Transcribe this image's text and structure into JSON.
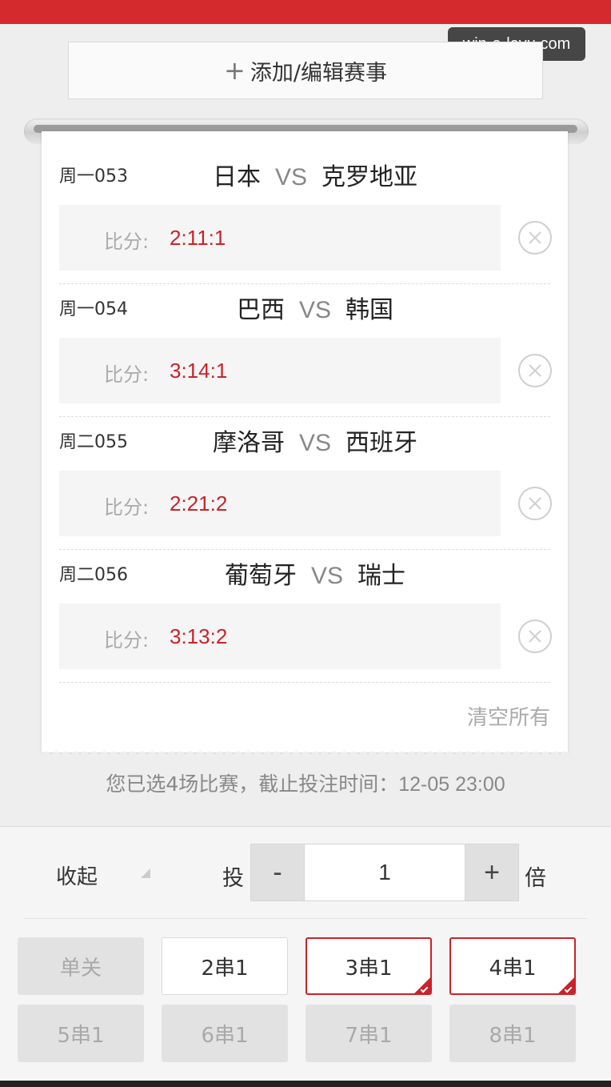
{
  "watermark": "win-e-leyu.com",
  "add_button": {
    "icon": "plus-icon",
    "label": "添加/编辑赛事"
  },
  "matches": [
    {
      "code": "周一053",
      "home": "日本",
      "vs": "VS",
      "away": "克罗地亚",
      "score_label": "比分:",
      "score": "2:11:1"
    },
    {
      "code": "周一054",
      "home": "巴西",
      "vs": "VS",
      "away": "韩国",
      "score_label": "比分:",
      "score": "3:14:1"
    },
    {
      "code": "周二055",
      "home": "摩洛哥",
      "vs": "VS",
      "away": "西班牙",
      "score_label": "比分:",
      "score": "2:21:2"
    },
    {
      "code": "周二056",
      "home": "葡萄牙",
      "vs": "VS",
      "away": "瑞士",
      "score_label": "比分:",
      "score": "3:13:2"
    }
  ],
  "clear_all": "清空所有",
  "summary": {
    "text": "您已选4场比赛，截止投注时间：",
    "deadline": "12-05 23:00"
  },
  "controls": {
    "collapse": "收起",
    "bet": "投",
    "minus": "-",
    "multiplier": "1",
    "plus": "+",
    "times": "倍"
  },
  "pass_types": [
    {
      "label": "单关",
      "state": "disabled"
    },
    {
      "label": "2串1",
      "state": "normal"
    },
    {
      "label": "3串1",
      "state": "selected"
    },
    {
      "label": "4串1",
      "state": "selected"
    },
    {
      "label": "5串1",
      "state": "disabled"
    },
    {
      "label": "6串1",
      "state": "disabled"
    },
    {
      "label": "7串1",
      "state": "disabled"
    },
    {
      "label": "8串1",
      "state": "disabled"
    }
  ],
  "colors": {
    "brand_red": "#d42a2e",
    "score_red": "#c8232b",
    "background": "#eeeeee"
  }
}
